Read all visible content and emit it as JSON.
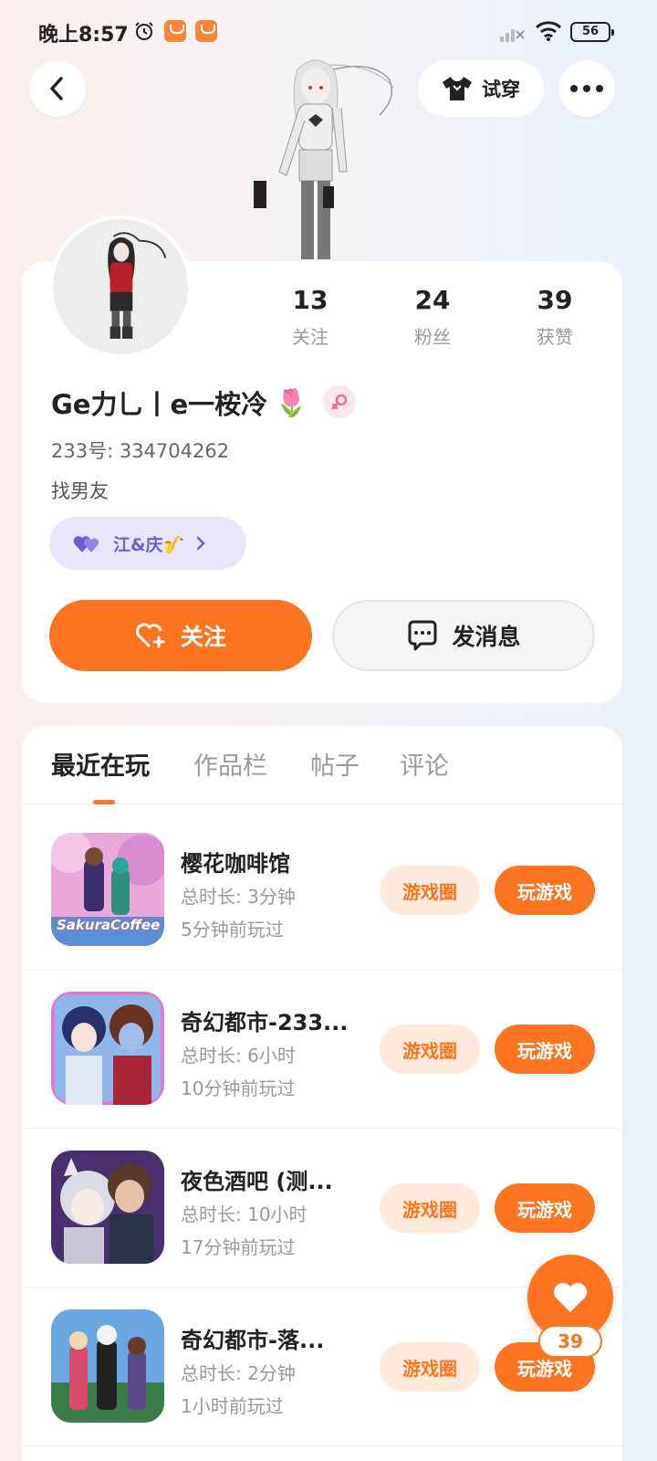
{
  "status_bar": {
    "time": "晚上8:57",
    "battery": "56"
  },
  "header": {
    "try_on_label": "试穿"
  },
  "profile": {
    "stats": [
      {
        "value": "13",
        "label": "关注"
      },
      {
        "value": "24",
        "label": "粉丝"
      },
      {
        "value": "39",
        "label": "获赞"
      }
    ],
    "nickname": "Ge力乚丨e一桉冷",
    "nickname_emoji": "🌷",
    "gender": "female",
    "uid": "233号: 334704262",
    "bio": "找男友",
    "couple_tag": "江&庆🎷",
    "follow_label": "关注",
    "message_label": "发消息"
  },
  "tabs": [
    {
      "label": "最近在玩",
      "active": true
    },
    {
      "label": "作品栏",
      "active": false
    },
    {
      "label": "帖子",
      "active": false
    },
    {
      "label": "评论",
      "active": false
    }
  ],
  "games": [
    {
      "title": "樱花咖啡馆",
      "duration": "总时长: 3分钟",
      "last_played": "5分钟前玩过",
      "thumb_text": "SakuraCoffee"
    },
    {
      "title": "奇幻都市-233...",
      "duration": "总时长: 6小时",
      "last_played": "10分钟前玩过",
      "thumb_text": ""
    },
    {
      "title": "夜色酒吧 (测...",
      "duration": "总时长: 10小时",
      "last_played": "17分钟前玩过",
      "thumb_text": ""
    },
    {
      "title": "奇幻都市-落...",
      "duration": "总时长: 2分钟",
      "last_played": "1小时前玩过",
      "thumb_text": ""
    }
  ],
  "game_actions": {
    "circle_label": "游戏圈",
    "play_label": "玩游戏"
  },
  "like_fab": {
    "count": "39"
  },
  "colors": {
    "accent": "#ff7420",
    "accent_light": "#ffeadb",
    "couple_bg": "#e9e6fb",
    "couple_text": "#6b5fd4"
  }
}
